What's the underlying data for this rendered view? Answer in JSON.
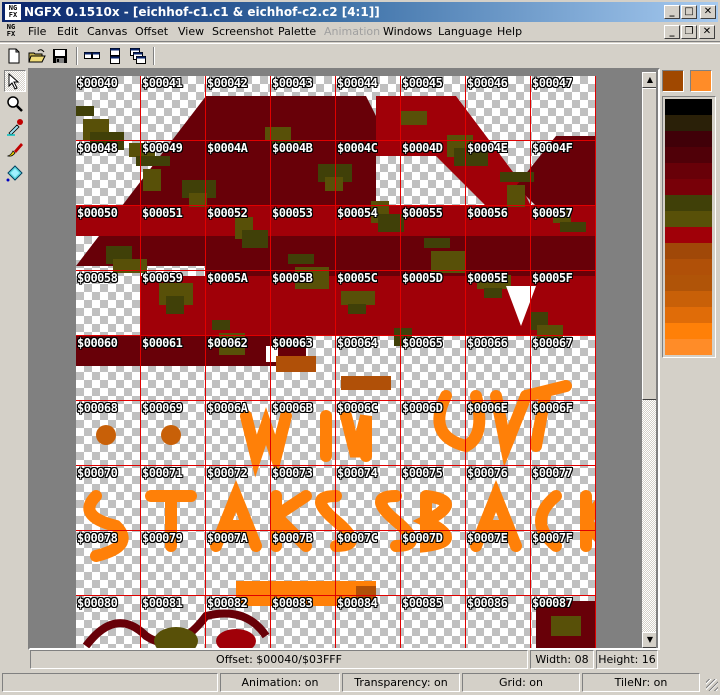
{
  "window": {
    "app_icon": "NG FX",
    "title": "NGFX 0.1510x  - [eichhof-c1.c1 & eichhof-c2.c2 [4:1]]",
    "controls": [
      "minimize",
      "maximize",
      "close"
    ]
  },
  "menubar": {
    "items": [
      {
        "label": "File",
        "enabled": true
      },
      {
        "label": "Edit",
        "enabled": true
      },
      {
        "label": "Canvas",
        "enabled": true
      },
      {
        "label": "Offset",
        "enabled": true
      },
      {
        "label": "View",
        "enabled": true
      },
      {
        "label": "Screenshot",
        "enabled": true
      },
      {
        "label": "Palette",
        "enabled": true
      },
      {
        "label": "Animation",
        "enabled": false
      },
      {
        "label": "Windows",
        "enabled": true
      },
      {
        "label": "Language",
        "enabled": true
      },
      {
        "label": "Help",
        "enabled": true
      }
    ],
    "mdi_controls": [
      "minimize",
      "restore",
      "close"
    ]
  },
  "toolbar": {
    "buttons": [
      "new-file-icon",
      "open-folder-icon",
      "save-disk-icon",
      "tile-horizontal-icon",
      "tile-vertical-icon",
      "cascade-windows-icon"
    ]
  },
  "tools": [
    {
      "name": "select-arrow-icon",
      "active": true
    },
    {
      "name": "zoom-magnifier-icon",
      "active": false
    },
    {
      "name": "eyedropper-icon",
      "active": false
    },
    {
      "name": "brush-icon",
      "active": false
    },
    {
      "name": "fill-bucket-icon",
      "active": false
    }
  ],
  "tiles": {
    "columns": 8,
    "labels": [
      [
        "$00040",
        "$00041",
        "$00042",
        "$00043",
        "$00044",
        "$00045",
        "$00046",
        "$00047"
      ],
      [
        "$00048",
        "$00049",
        "$0004A",
        "$0004B",
        "$0004C",
        "$0004D",
        "$0004E",
        "$0004F"
      ],
      [
        "$00050",
        "$00051",
        "$00052",
        "$00053",
        "$00054",
        "$00055",
        "$00056",
        "$00057"
      ],
      [
        "$00058",
        "$00059",
        "$0005A",
        "$0005B",
        "$0005C",
        "$0005D",
        "$0005E",
        "$0005F"
      ],
      [
        "$00060",
        "$00061",
        "$00062",
        "$00063",
        "$00064",
        "$00065",
        "$00066",
        "$00067"
      ],
      [
        "$00068",
        "$00069",
        "$0006A",
        "$0006B",
        "$0006C",
        "$0006D",
        "$0006E",
        "$0006F"
      ],
      [
        "$00070",
        "$00071",
        "$00072",
        "$00073",
        "$00074",
        "$00075",
        "$00076",
        "$00077"
      ],
      [
        "$00078",
        "$00079",
        "$0007A",
        "$0007B",
        "$0007C",
        "$0007D",
        "$0007E",
        "$0007F"
      ],
      [
        "$00080",
        "$00081",
        "$00082",
        "$00083",
        "$00084",
        "$00085",
        "$00086",
        "$00087"
      ]
    ]
  },
  "colors": {
    "grid_line": "#e00000",
    "foreground": "#a04800",
    "background": "#ff8c28",
    "palette": [
      "#000000",
      "#2a2008",
      "#400008",
      "#500008",
      "#680008",
      "#780008",
      "#404008",
      "#585008",
      "#a00008",
      "#a04808",
      "#b05008",
      "#b05408",
      "#c86008",
      "#e06c08",
      "#ff8008",
      "#ff8c28"
    ]
  },
  "canvas_status": {
    "offset": "Offset: $00040/$03FFF",
    "width": "Width: 08",
    "height": "Height: 16"
  },
  "statusbar": {
    "animation": "Animation: on",
    "transparency": "Transparency: on",
    "grid": "Grid: on",
    "tilenr": "TileNr: on"
  }
}
